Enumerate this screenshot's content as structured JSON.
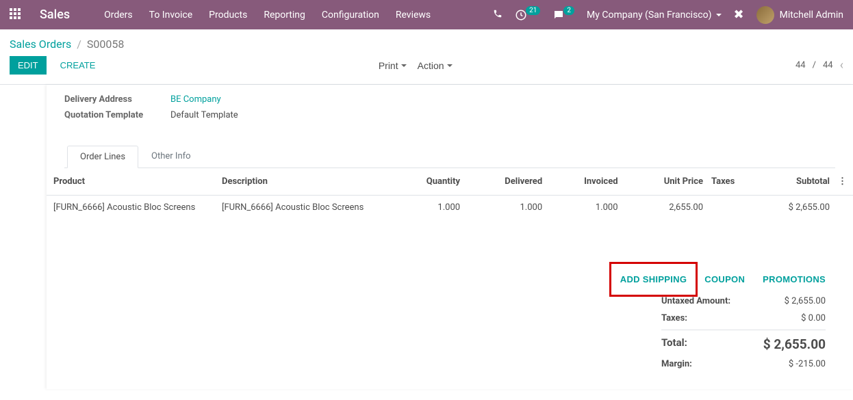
{
  "topbar": {
    "brand": "Sales",
    "menu": [
      "Orders",
      "To Invoice",
      "Products",
      "Reporting",
      "Configuration",
      "Reviews"
    ],
    "activity_badge": "21",
    "messages_badge": "2",
    "company": "My Company (San Francisco)",
    "user": "Mitchell Admin"
  },
  "breadcrumb": {
    "parent": "Sales Orders",
    "current": "S00058"
  },
  "buttons": {
    "edit": "Edit",
    "create": "Create",
    "print": "Print",
    "action": "Action"
  },
  "pager": {
    "page": "44",
    "total": "44"
  },
  "fields": {
    "delivery_label": "Delivery Address",
    "delivery_value": "BE Company",
    "template_label": "Quotation Template",
    "template_value": "Default Template"
  },
  "tabs": {
    "lines": "Order Lines",
    "other": "Other Info"
  },
  "columns": {
    "product": "Product",
    "description": "Description",
    "qty": "Quantity",
    "delivered": "Delivered",
    "invoiced": "Invoiced",
    "unit_price": "Unit Price",
    "taxes": "Taxes",
    "subtotal": "Subtotal"
  },
  "lines": [
    {
      "product": "[FURN_6666] Acoustic Bloc Screens",
      "description": "[FURN_6666] Acoustic Bloc Screens",
      "qty": "1.000",
      "delivered": "1.000",
      "invoiced": "1.000",
      "unit_price": "2,655.00",
      "taxes": "",
      "subtotal": "$ 2,655.00"
    }
  ],
  "action_links": {
    "shipping": "Add Shipping",
    "coupon": "Coupon",
    "promotions": "Promotions"
  },
  "totals": {
    "untaxed_label": "Untaxed Amount:",
    "untaxed_value": "$ 2,655.00",
    "taxes_label": "Taxes:",
    "taxes_value": "$ 0.00",
    "total_label": "Total:",
    "total_value": "$ 2,655.00",
    "margin_label": "Margin:",
    "margin_value": "$ -215.00"
  }
}
